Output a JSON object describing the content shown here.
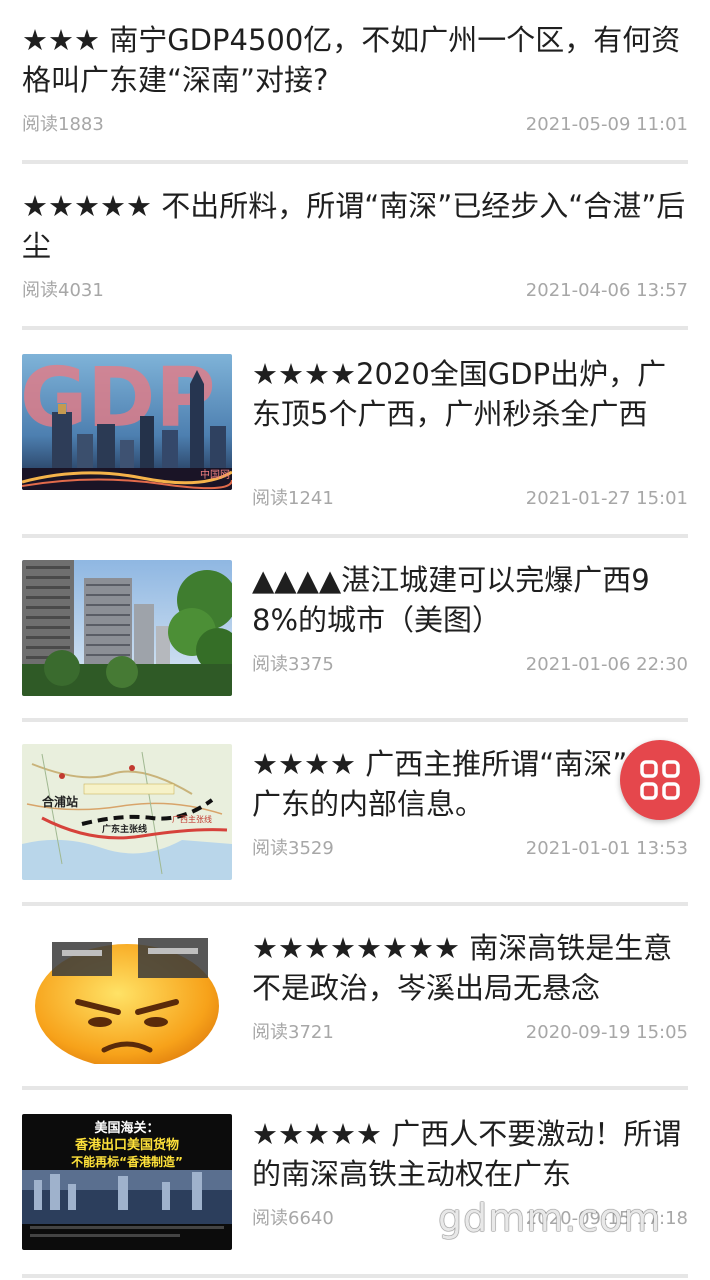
{
  "articles": [
    {
      "title": "★★★ 南宁GDP4500亿，不如广州一个区，有何资格叫广东建“深南”对接?",
      "reads": "阅读1883",
      "date": "2021-05-09 11:01"
    },
    {
      "title": "★★★★★ 不出所料，所谓“南深”已经步入“合湛”后尘",
      "reads": "阅读4031",
      "date": "2021-04-06 13:57"
    },
    {
      "title": "★★★★2020全国GDP出炉，广东顶5个广西，广州秒杀全广西",
      "reads": "阅读1241",
      "date": "2021-01-27 15:01",
      "thumb_text": "GDP",
      "thumb_caption": "中国网"
    },
    {
      "title": "▲▲▲▲湛江城建可以完爆广西98%的城市（美图）",
      "reads": "阅读3375",
      "date": "2021-01-06 22:30"
    },
    {
      "title": "★★★★ 广西主推所谓“南深”来自广东的内部信息。",
      "reads": "阅读3529",
      "date": "2021-01-01 13:53",
      "thumb_labels": [
        "合浦站",
        "广东主张线",
        "广西主张线"
      ]
    },
    {
      "title": "★★★★★★★★ 南深高铁是生意不是政治，岑溪出局无悬念",
      "reads": "阅读3721",
      "date": "2020-09-19 15:05"
    },
    {
      "title": "★★★★★ 广西人不要激动！所谓的南深高铁主动权在广东",
      "reads": "阅读6640",
      "date": "2020-09-15 17:18",
      "thumb_lines": [
        "美国海关：",
        "香港出口美国货物",
        "不能再标“香港制造”"
      ]
    }
  ],
  "watermark": "gdmm.com",
  "icons": {
    "float_button": "grid-apps-icon"
  },
  "colors": {
    "float_button": "#e5474c",
    "separator": "#e6e6e6",
    "title": "#1f1f1f",
    "meta": "#a7a7a7"
  }
}
